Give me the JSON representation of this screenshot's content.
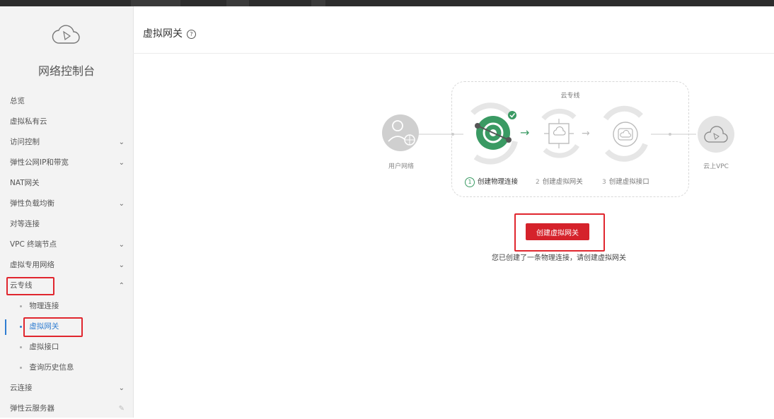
{
  "app": {
    "title": "网络控制台"
  },
  "sidebar": {
    "items": [
      {
        "label": "总览"
      },
      {
        "label": "虚拟私有云"
      },
      {
        "label": "访问控制",
        "chevron": "⌄"
      },
      {
        "label": "弹性公网IP和带宽",
        "chevron": "⌄"
      },
      {
        "label": "NAT网关"
      },
      {
        "label": "弹性负载均衡",
        "chevron": "⌄"
      },
      {
        "label": "对等连接"
      },
      {
        "label": "VPC 终端节点",
        "chevron": "⌄"
      },
      {
        "label": "虚拟专用网络",
        "chevron": "⌄"
      },
      {
        "label": "云专线",
        "chevron": "⌃"
      },
      {
        "label": "物理连接"
      },
      {
        "label": "虚拟网关"
      },
      {
        "label": "虚拟接口"
      },
      {
        "label": "查询历史信息"
      },
      {
        "label": "云连接",
        "chevron": "⌄"
      },
      {
        "label": "弹性云服务器",
        "icon": "pencil-icon"
      }
    ]
  },
  "page": {
    "title": "虚拟网关",
    "help_icon": "?"
  },
  "flow": {
    "group_label": "云专线",
    "user_network_label": "用户网络",
    "cloud_vpc_label": "云上VPC",
    "steps": [
      {
        "num": "1",
        "label": "创建物理连接",
        "status": "done"
      },
      {
        "num": "2",
        "label": "创建虚拟网关",
        "status": "pending"
      },
      {
        "num": "3",
        "label": "创建虚拟接口",
        "status": "pending"
      }
    ]
  },
  "action": {
    "create_button": "创建虚拟网关",
    "hint": "您已创建了一条物理连接，请创建虚拟网关"
  },
  "colors": {
    "accent": "#2f7dd1",
    "danger": "#d5222b",
    "success": "#3a9a63"
  }
}
